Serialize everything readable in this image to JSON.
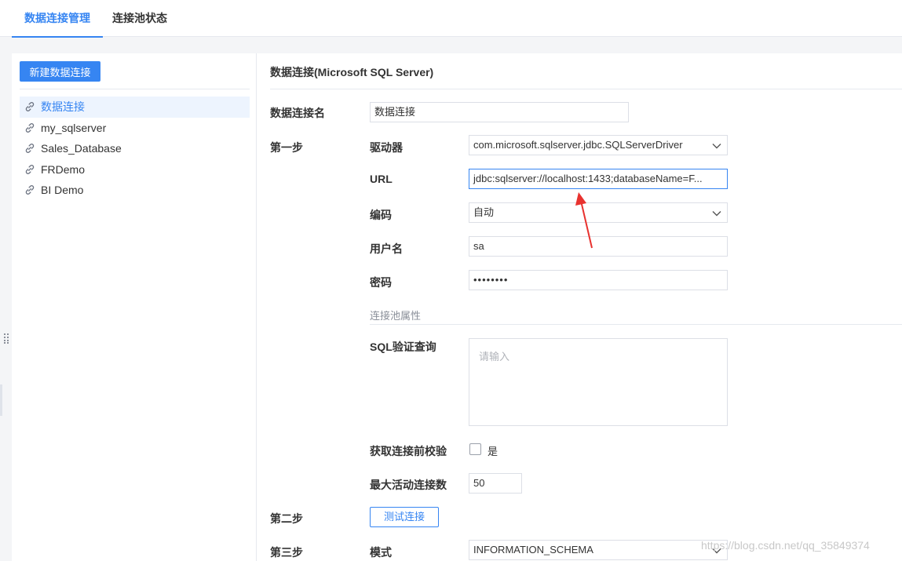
{
  "tabs": [
    {
      "label": "数据连接管理",
      "active": true
    },
    {
      "label": "连接池状态",
      "active": false
    }
  ],
  "sidebar": {
    "new_button": "新建数据连接",
    "connections": [
      "数据连接",
      "my_sqlserver",
      "Sales_Database",
      "FRDemo",
      "BI Demo"
    ],
    "selected_index": 0
  },
  "form": {
    "title": "数据连接(Microsoft SQL Server)",
    "name_label": "数据连接名",
    "name_value": "数据连接",
    "step1_label": "第一步",
    "driver_label": "驱动器",
    "driver_value": "com.microsoft.sqlserver.jdbc.SQLServerDriver",
    "url_label": "URL",
    "url_value": "jdbc:sqlserver://localhost:1433;databaseName=F...",
    "encoding_label": "编码",
    "encoding_value": "自动",
    "username_label": "用户名",
    "username_value": "sa",
    "password_label": "密码",
    "password_value": "••••••••",
    "pool_section_label": "连接池属性",
    "sql_validation_label": "SQL验证查询",
    "sql_validation_placeholder": "请输入",
    "validate_before_label": "获取连接前校验",
    "validate_before_option": "是",
    "validate_before_checked": false,
    "max_active_label": "最大活动连接数",
    "max_active_value": "50",
    "step2_label": "第二步",
    "test_button": "测试连接",
    "step3_label": "第三步",
    "schema_label": "模式",
    "schema_value": "INFORMATION_SCHEMA"
  },
  "watermark": "https://blog.csdn.net/qq_35849374",
  "colors": {
    "accent": "#3685f2",
    "annotation_arrow": "#e8322f"
  }
}
